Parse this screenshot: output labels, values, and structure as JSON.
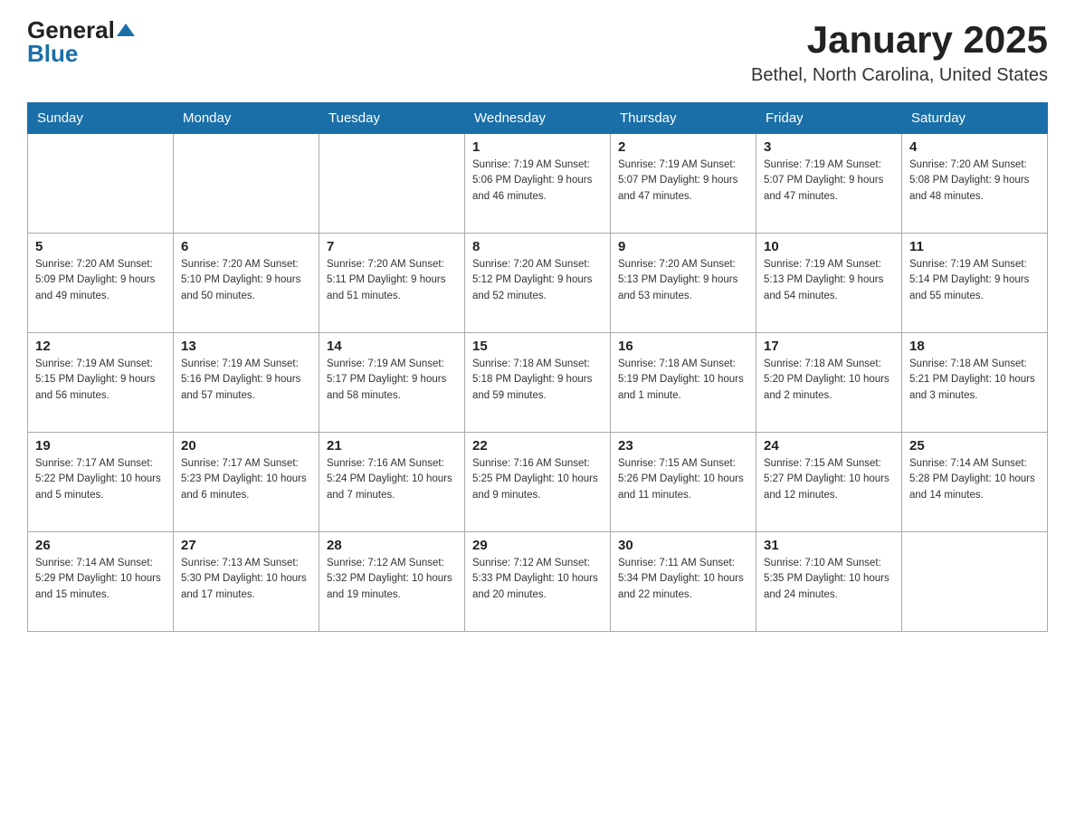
{
  "header": {
    "logo_general": "General",
    "logo_blue": "Blue",
    "month_title": "January 2025",
    "location": "Bethel, North Carolina, United States"
  },
  "days_of_week": [
    "Sunday",
    "Monday",
    "Tuesday",
    "Wednesday",
    "Thursday",
    "Friday",
    "Saturday"
  ],
  "weeks": [
    [
      {
        "day": "",
        "info": ""
      },
      {
        "day": "",
        "info": ""
      },
      {
        "day": "",
        "info": ""
      },
      {
        "day": "1",
        "info": "Sunrise: 7:19 AM\nSunset: 5:06 PM\nDaylight: 9 hours\nand 46 minutes."
      },
      {
        "day": "2",
        "info": "Sunrise: 7:19 AM\nSunset: 5:07 PM\nDaylight: 9 hours\nand 47 minutes."
      },
      {
        "day": "3",
        "info": "Sunrise: 7:19 AM\nSunset: 5:07 PM\nDaylight: 9 hours\nand 47 minutes."
      },
      {
        "day": "4",
        "info": "Sunrise: 7:20 AM\nSunset: 5:08 PM\nDaylight: 9 hours\nand 48 minutes."
      }
    ],
    [
      {
        "day": "5",
        "info": "Sunrise: 7:20 AM\nSunset: 5:09 PM\nDaylight: 9 hours\nand 49 minutes."
      },
      {
        "day": "6",
        "info": "Sunrise: 7:20 AM\nSunset: 5:10 PM\nDaylight: 9 hours\nand 50 minutes."
      },
      {
        "day": "7",
        "info": "Sunrise: 7:20 AM\nSunset: 5:11 PM\nDaylight: 9 hours\nand 51 minutes."
      },
      {
        "day": "8",
        "info": "Sunrise: 7:20 AM\nSunset: 5:12 PM\nDaylight: 9 hours\nand 52 minutes."
      },
      {
        "day": "9",
        "info": "Sunrise: 7:20 AM\nSunset: 5:13 PM\nDaylight: 9 hours\nand 53 minutes."
      },
      {
        "day": "10",
        "info": "Sunrise: 7:19 AM\nSunset: 5:13 PM\nDaylight: 9 hours\nand 54 minutes."
      },
      {
        "day": "11",
        "info": "Sunrise: 7:19 AM\nSunset: 5:14 PM\nDaylight: 9 hours\nand 55 minutes."
      }
    ],
    [
      {
        "day": "12",
        "info": "Sunrise: 7:19 AM\nSunset: 5:15 PM\nDaylight: 9 hours\nand 56 minutes."
      },
      {
        "day": "13",
        "info": "Sunrise: 7:19 AM\nSunset: 5:16 PM\nDaylight: 9 hours\nand 57 minutes."
      },
      {
        "day": "14",
        "info": "Sunrise: 7:19 AM\nSunset: 5:17 PM\nDaylight: 9 hours\nand 58 minutes."
      },
      {
        "day": "15",
        "info": "Sunrise: 7:18 AM\nSunset: 5:18 PM\nDaylight: 9 hours\nand 59 minutes."
      },
      {
        "day": "16",
        "info": "Sunrise: 7:18 AM\nSunset: 5:19 PM\nDaylight: 10 hours\nand 1 minute."
      },
      {
        "day": "17",
        "info": "Sunrise: 7:18 AM\nSunset: 5:20 PM\nDaylight: 10 hours\nand 2 minutes."
      },
      {
        "day": "18",
        "info": "Sunrise: 7:18 AM\nSunset: 5:21 PM\nDaylight: 10 hours\nand 3 minutes."
      }
    ],
    [
      {
        "day": "19",
        "info": "Sunrise: 7:17 AM\nSunset: 5:22 PM\nDaylight: 10 hours\nand 5 minutes."
      },
      {
        "day": "20",
        "info": "Sunrise: 7:17 AM\nSunset: 5:23 PM\nDaylight: 10 hours\nand 6 minutes."
      },
      {
        "day": "21",
        "info": "Sunrise: 7:16 AM\nSunset: 5:24 PM\nDaylight: 10 hours\nand 7 minutes."
      },
      {
        "day": "22",
        "info": "Sunrise: 7:16 AM\nSunset: 5:25 PM\nDaylight: 10 hours\nand 9 minutes."
      },
      {
        "day": "23",
        "info": "Sunrise: 7:15 AM\nSunset: 5:26 PM\nDaylight: 10 hours\nand 11 minutes."
      },
      {
        "day": "24",
        "info": "Sunrise: 7:15 AM\nSunset: 5:27 PM\nDaylight: 10 hours\nand 12 minutes."
      },
      {
        "day": "25",
        "info": "Sunrise: 7:14 AM\nSunset: 5:28 PM\nDaylight: 10 hours\nand 14 minutes."
      }
    ],
    [
      {
        "day": "26",
        "info": "Sunrise: 7:14 AM\nSunset: 5:29 PM\nDaylight: 10 hours\nand 15 minutes."
      },
      {
        "day": "27",
        "info": "Sunrise: 7:13 AM\nSunset: 5:30 PM\nDaylight: 10 hours\nand 17 minutes."
      },
      {
        "day": "28",
        "info": "Sunrise: 7:12 AM\nSunset: 5:32 PM\nDaylight: 10 hours\nand 19 minutes."
      },
      {
        "day": "29",
        "info": "Sunrise: 7:12 AM\nSunset: 5:33 PM\nDaylight: 10 hours\nand 20 minutes."
      },
      {
        "day": "30",
        "info": "Sunrise: 7:11 AM\nSunset: 5:34 PM\nDaylight: 10 hours\nand 22 minutes."
      },
      {
        "day": "31",
        "info": "Sunrise: 7:10 AM\nSunset: 5:35 PM\nDaylight: 10 hours\nand 24 minutes."
      },
      {
        "day": "",
        "info": ""
      }
    ]
  ]
}
